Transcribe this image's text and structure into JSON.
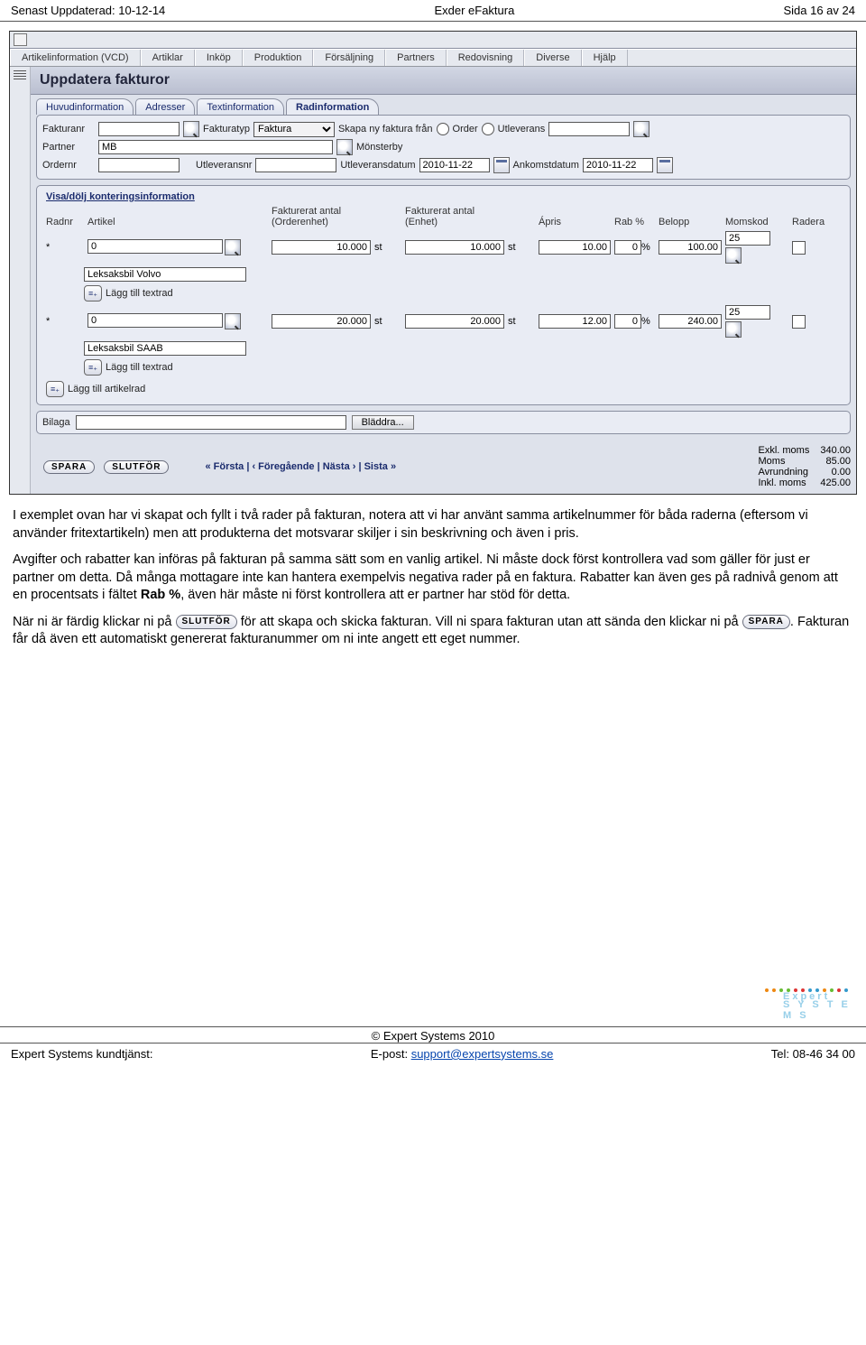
{
  "header": {
    "updated": "Senast Uppdaterad: 10-12-14",
    "title": "Exder eFaktura",
    "page": "Sida 16 av 24"
  },
  "menubar": [
    "Artikelinformation (VCD)",
    "Artiklar",
    "Inköp",
    "Produktion",
    "Försäljning",
    "Partners",
    "Redovisning",
    "Diverse",
    "Hjälp"
  ],
  "page_title": "Uppdatera fakturor",
  "tabs": [
    "Huvudinformation",
    "Adresser",
    "Textinformation",
    "Radinformation"
  ],
  "active_tab": 3,
  "form": {
    "fakturanr_lbl": "Fakturanr",
    "fakturanr": "",
    "fakturatyp_lbl": "Fakturatyp",
    "fakturatyp": "Faktura",
    "skapa_lbl": "Skapa ny faktura från",
    "opt_order": "Order",
    "opt_utl": "Utleverans",
    "skapa_val": "",
    "partner_lbl": "Partner",
    "partner": "MB",
    "partner_name": "Mönsterby",
    "ordernr_lbl": "Ordernr",
    "ordernr": "",
    "utlnr_lbl": "Utleveransnr",
    "utlnr": "",
    "utldatum_lbl": "Utleveransdatum",
    "utldatum": "2010-11-22",
    "ankdatum_lbl": "Ankomstdatum",
    "ankdatum": "2010-11-22"
  },
  "section_link": "Visa/dölj konteringsinformation",
  "cols": {
    "radnr": "Radnr",
    "artikel": "Artikel",
    "fa_order": "Fakturerat antal (Orderenhet)",
    "fa_enhet": "Fakturerat antal (Enhet)",
    "apris": "Ápris",
    "rab": "Rab %",
    "belopp": "Belopp",
    "momskod": "Momskod",
    "radera": "Radera"
  },
  "rows": [
    {
      "radnr": "*",
      "art": "0",
      "art_name": "Leksaksbil Volvo",
      "q1": "10.000",
      "u1": "st",
      "q2": "10.000",
      "u2": "st",
      "apris": "10.00",
      "rab": "0",
      "belopp": "100.00",
      "moms": "25"
    },
    {
      "radnr": "*",
      "art": "0",
      "art_name": "Leksaksbil SAAB",
      "q1": "20.000",
      "u1": "st",
      "q2": "20.000",
      "u2": "st",
      "apris": "12.00",
      "rab": "0",
      "belopp": "240.00",
      "moms": "25"
    }
  ],
  "add_textrad": "Lägg till textrad",
  "add_artikelrad": "Lägg till artikelrad",
  "bilaga_lbl": "Bilaga",
  "browse": "Bläddra...",
  "buttons": {
    "spara": "SPARA",
    "slutfor": "SLUTFÖR"
  },
  "pager": "« Första | ‹ Föregående | Nästa › | Sista »",
  "totals": {
    "exkl_lbl": "Exkl. moms",
    "exkl": "340.00",
    "moms_lbl": "Moms",
    "moms": "85.00",
    "avr_lbl": "Avrundning",
    "avr": "0.00",
    "inkl_lbl": "Inkl. moms",
    "inkl": "425.00"
  },
  "body": {
    "p1": "I exemplet ovan har vi skapat och fyllt i två rader på fakturan, notera att vi har använt samma artikelnummer för båda raderna (eftersom vi använder fritextartikeln) men att produkterna det motsvarar skiljer i sin beskrivning och även i pris.",
    "p2a": "Avgifter och rabatter kan införas på fakturan på samma sätt som en vanlig artikel. Ni måste dock först kontrollera vad som gäller för just er partner om detta. Då många mottagare inte kan hantera exempelvis negativa rader på en faktura. Rabatter kan även ges på radnivå genom att en procentsats i fältet ",
    "p2b_bold": "Rab %",
    "p2c": ", även här måste ni först kontrollera att er partner har stöd för detta.",
    "p3a": "När ni är färdig klickar ni på ",
    "p3b": " för att skapa och skicka fakturan. Vill ni spara fakturan utan att sända den klickar ni på ",
    "p3c": ". Fakturan får då även ett automatiskt genererat fakturanummer om ni inte angett ett eget nummer."
  },
  "footer": {
    "copy": "© Expert Systems 2010",
    "left": "Expert Systems kundtjänst:",
    "mid_lbl": "E-post: ",
    "mid_link": "support@expertsystems.se",
    "right": "Tel: 08-46 34 00",
    "logo": "Expert",
    "logo_sub": "S Y S T E M S"
  }
}
